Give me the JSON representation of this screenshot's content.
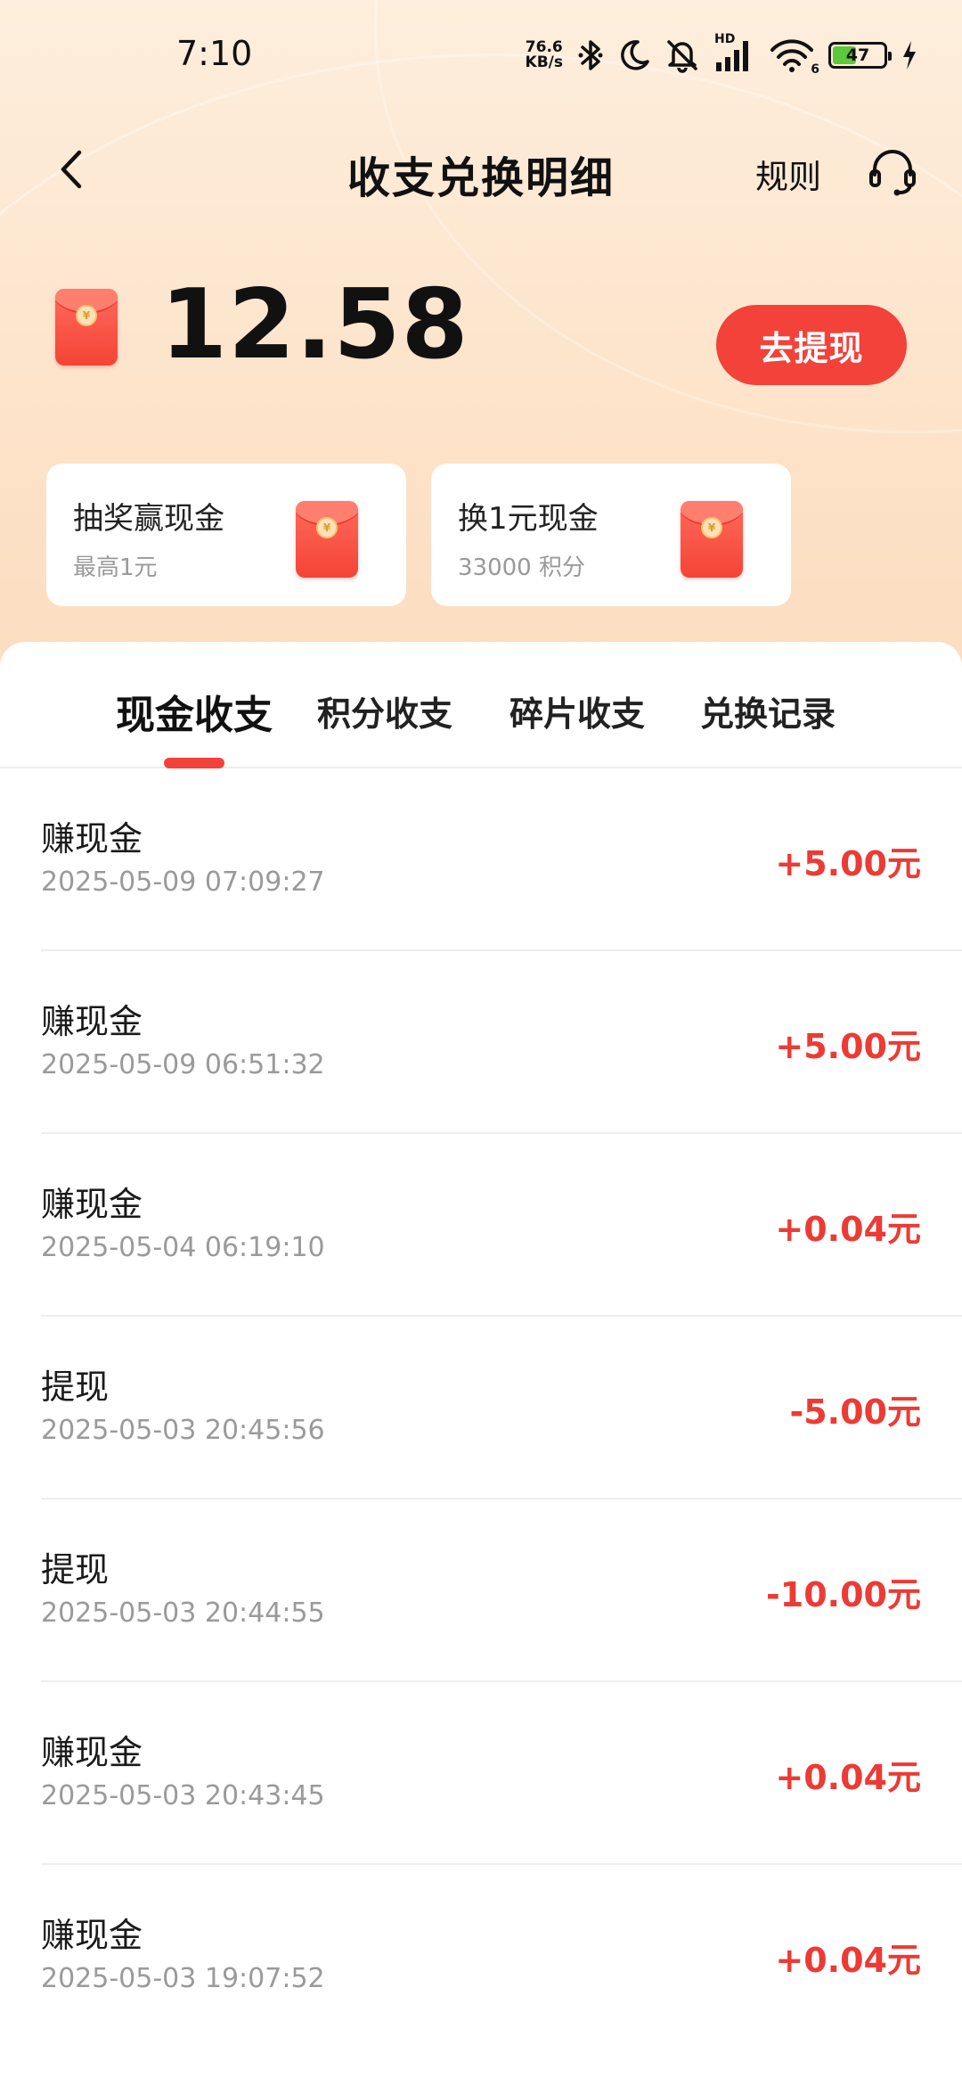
{
  "status_bar": {
    "time": "7:10",
    "net_speed_value": "76.6",
    "net_speed_unit": "KB/s",
    "hd_label": "HD",
    "wifi_label": "6",
    "battery_level": "47"
  },
  "header": {
    "title": "收支兑换明细",
    "rules_label": "规则"
  },
  "balance": {
    "amount": "12.58",
    "withdraw_label": "去提现"
  },
  "promo_cards": [
    {
      "title": "抽奖赢现金",
      "subtitle": "最高1元"
    },
    {
      "title": "换1元现金",
      "subtitle": "33000 积分"
    }
  ],
  "tabs": [
    {
      "label": "现金收支",
      "active": true
    },
    {
      "label": "积分收支",
      "active": false
    },
    {
      "label": "碎片收支",
      "active": false
    },
    {
      "label": "兑换记录",
      "active": false
    }
  ],
  "transactions": [
    {
      "title": "赚现金",
      "time": "2025-05-09 07:09:27",
      "amount": "+5.00元"
    },
    {
      "title": "赚现金",
      "time": "2025-05-09 06:51:32",
      "amount": "+5.00元"
    },
    {
      "title": "赚现金",
      "time": "2025-05-04 06:19:10",
      "amount": "+0.04元"
    },
    {
      "title": "提现",
      "time": "2025-05-03 20:45:56",
      "amount": "-5.00元"
    },
    {
      "title": "提现",
      "time": "2025-05-03 20:44:55",
      "amount": "-10.00元"
    },
    {
      "title": "赚现金",
      "time": "2025-05-03 20:43:45",
      "amount": "+0.04元"
    },
    {
      "title": "赚现金",
      "time": "2025-05-03 19:07:52",
      "amount": "+0.04元"
    }
  ],
  "colors": {
    "accent": "#f2423a",
    "amount": "#ec3b35",
    "header_bg": "#fde4cb"
  }
}
